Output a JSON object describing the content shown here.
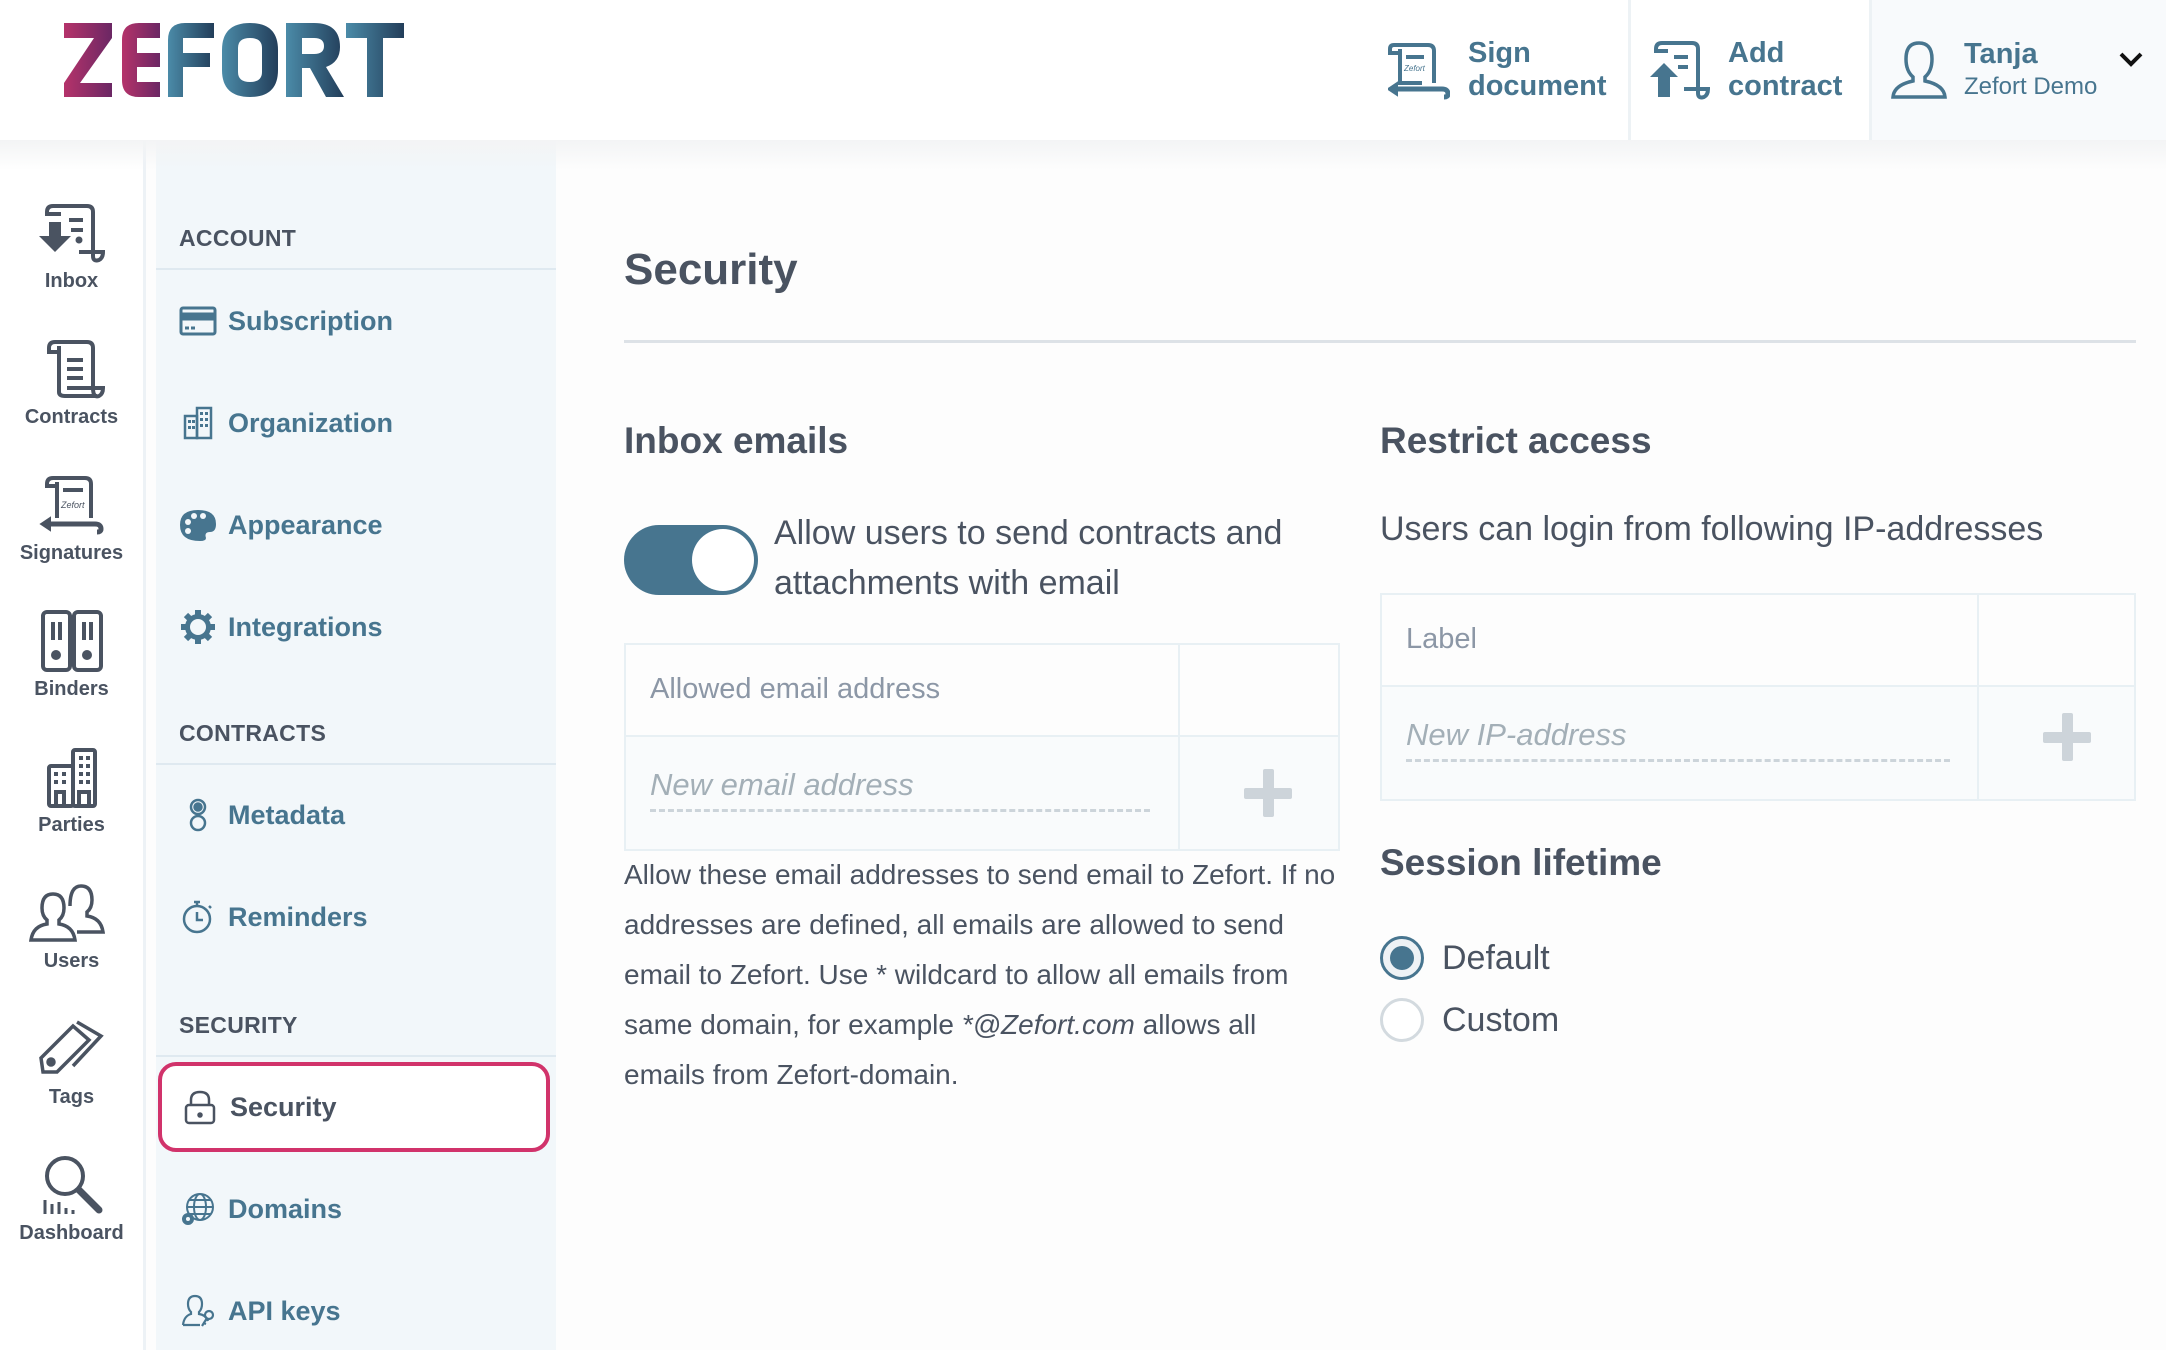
{
  "brand": {
    "name": "ZEFORT",
    "colors": {
      "accent": "#47758f",
      "active_outline": "#d1336b",
      "text": "#4a5361",
      "subnav_bg": "#f2f7fa"
    }
  },
  "header": {
    "actions": [
      {
        "icon": "sign-document-icon",
        "line1": "Sign",
        "line2": "document"
      },
      {
        "icon": "add-contract-icon",
        "line1": "Add",
        "line2": "contract"
      }
    ],
    "user": {
      "icon": "user-avatar-icon",
      "name": "Tanja",
      "organization": "Zefort Demo",
      "menu_icon": "chevron-down-icon"
    }
  },
  "rail": {
    "items": [
      {
        "label": "Inbox",
        "icon": "inbox-icon"
      },
      {
        "label": "Contracts",
        "icon": "contracts-icon"
      },
      {
        "label": "Signatures",
        "icon": "signatures-icon"
      },
      {
        "label": "Binders",
        "icon": "binders-icon"
      },
      {
        "label": "Parties",
        "icon": "parties-icon"
      },
      {
        "label": "Users",
        "icon": "users-icon"
      },
      {
        "label": "Tags",
        "icon": "tags-icon"
      },
      {
        "label": "Dashboard",
        "icon": "dashboard-icon"
      }
    ]
  },
  "settings_nav": {
    "sections": [
      {
        "title": "ACCOUNT",
        "items": [
          {
            "label": "Subscription",
            "icon": "credit-card-icon"
          },
          {
            "label": "Organization",
            "icon": "building-icon"
          },
          {
            "label": "Appearance",
            "icon": "palette-icon"
          },
          {
            "label": "Integrations",
            "icon": "gear-icon"
          }
        ]
      },
      {
        "title": "CONTRACTS",
        "items": [
          {
            "label": "Metadata",
            "icon": "metadata-icon"
          },
          {
            "label": "Reminders",
            "icon": "stopwatch-icon"
          }
        ]
      },
      {
        "title": "SECURITY",
        "items": [
          {
            "label": "Security",
            "icon": "lock-icon",
            "active": true
          },
          {
            "label": "Domains",
            "icon": "globe-gear-icon"
          },
          {
            "label": "API keys",
            "icon": "user-key-icon"
          }
        ]
      }
    ]
  },
  "main": {
    "title": "Security",
    "inbox_emails": {
      "heading": "Inbox emails",
      "toggle_label": "Allow users to send contracts and attachments with email",
      "toggle_on": true,
      "table_header": "Allowed email address",
      "new_placeholder": "New email address",
      "help_part1": "Allow these email addresses to send email to Zefort. If no addresses are defined, all emails are allowed to send email to Zefort. Use * wildcard to allow all emails from same domain, for example ",
      "help_example": "*@Zefort.com",
      "help_part2": " allows all emails from Zefort-domain."
    },
    "restrict_access": {
      "heading": "Restrict access",
      "description": "Users can login from following IP-addresses",
      "table_header": "Label",
      "new_placeholder": "New IP-address"
    },
    "session_lifetime": {
      "heading": "Session lifetime",
      "options": [
        {
          "label": "Default",
          "checked": true
        },
        {
          "label": "Custom",
          "checked": false
        }
      ]
    }
  }
}
